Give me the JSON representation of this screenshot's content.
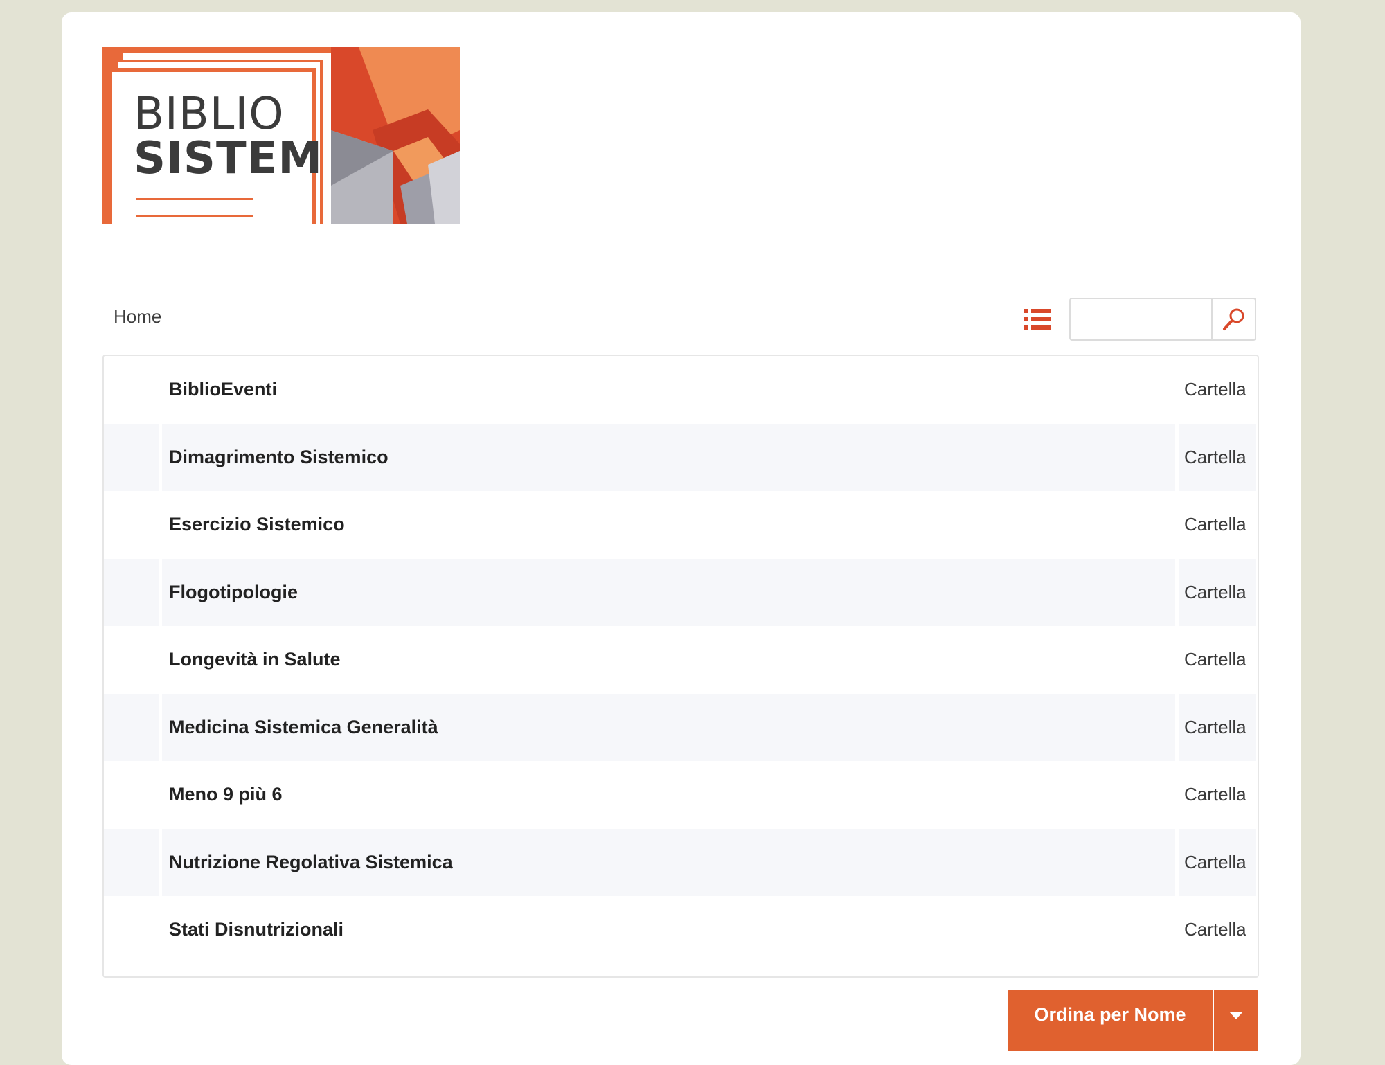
{
  "brand": {
    "logo_line1": "BIBLIO",
    "logo_line2": "SISTEM",
    "accent_color": "#e0612f"
  },
  "toolbar": {
    "breadcrumb": "Home",
    "view_toggle_icon": "list-view-icon",
    "search_placeholder": "",
    "search_icon": "search-icon"
  },
  "folders": [
    {
      "name": "BiblioEventi",
      "type": "Cartella"
    },
    {
      "name": "Dimagrimento Sistemico",
      "type": "Cartella"
    },
    {
      "name": "Esercizio Sistemico",
      "type": "Cartella"
    },
    {
      "name": "Flogotipologie",
      "type": "Cartella"
    },
    {
      "name": "Longevità in Salute",
      "type": "Cartella"
    },
    {
      "name": "Medicina Sistemica Generalità",
      "type": "Cartella"
    },
    {
      "name": "Meno 9 più 6",
      "type": "Cartella"
    },
    {
      "name": "Nutrizione Regolativa Sistemica",
      "type": "Cartella"
    },
    {
      "name": "Stati Disnutrizionali",
      "type": "Cartella"
    }
  ],
  "sort": {
    "label": "Ordina per Nome",
    "caret_icon": "caret-down-icon"
  }
}
